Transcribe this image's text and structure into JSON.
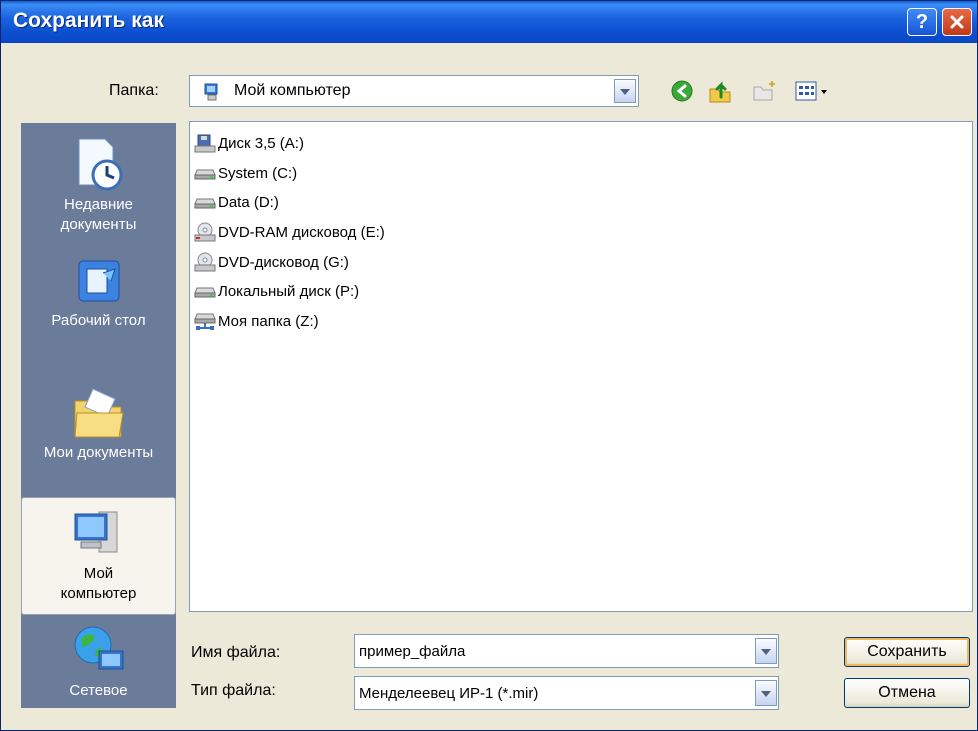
{
  "window": {
    "title": "Сохранить как"
  },
  "toolbar": {
    "folder_label": "Папка:",
    "folder_value": "Мой компьютер"
  },
  "places": [
    {
      "label_1": "Недавние",
      "label_2": "документы"
    },
    {
      "label_1": "Рабочий стол",
      "label_2": ""
    },
    {
      "label_1": "Мои документы",
      "label_2": ""
    },
    {
      "label_1": "Мой",
      "label_2": "компьютер"
    },
    {
      "label_1": "Сетевое",
      "label_2": ""
    }
  ],
  "files": [
    {
      "name": "Диск 3,5 (A:)",
      "icon": "floppy-drive-icon"
    },
    {
      "name": "System (C:)",
      "icon": "hard-drive-icon"
    },
    {
      "name": "Data (D:)",
      "icon": "hard-drive-icon"
    },
    {
      "name": "DVD-RAM дисковод (E:)",
      "icon": "dvd-drive-icon"
    },
    {
      "name": "DVD-дисковод (G:)",
      "icon": "dvd-drive-icon"
    },
    {
      "name": "Локальный диск (P:)",
      "icon": "hard-drive-icon"
    },
    {
      "name": "Моя папка (Z:)",
      "icon": "network-drive-icon"
    }
  ],
  "filename": {
    "label": "Имя файла:",
    "value": "пример_файла"
  },
  "filetype": {
    "label": "Тип файла:",
    "value": "Менделеевец ИР-1 (*.mir)"
  },
  "buttons": {
    "save": "Сохранить",
    "cancel": "Отмена"
  }
}
